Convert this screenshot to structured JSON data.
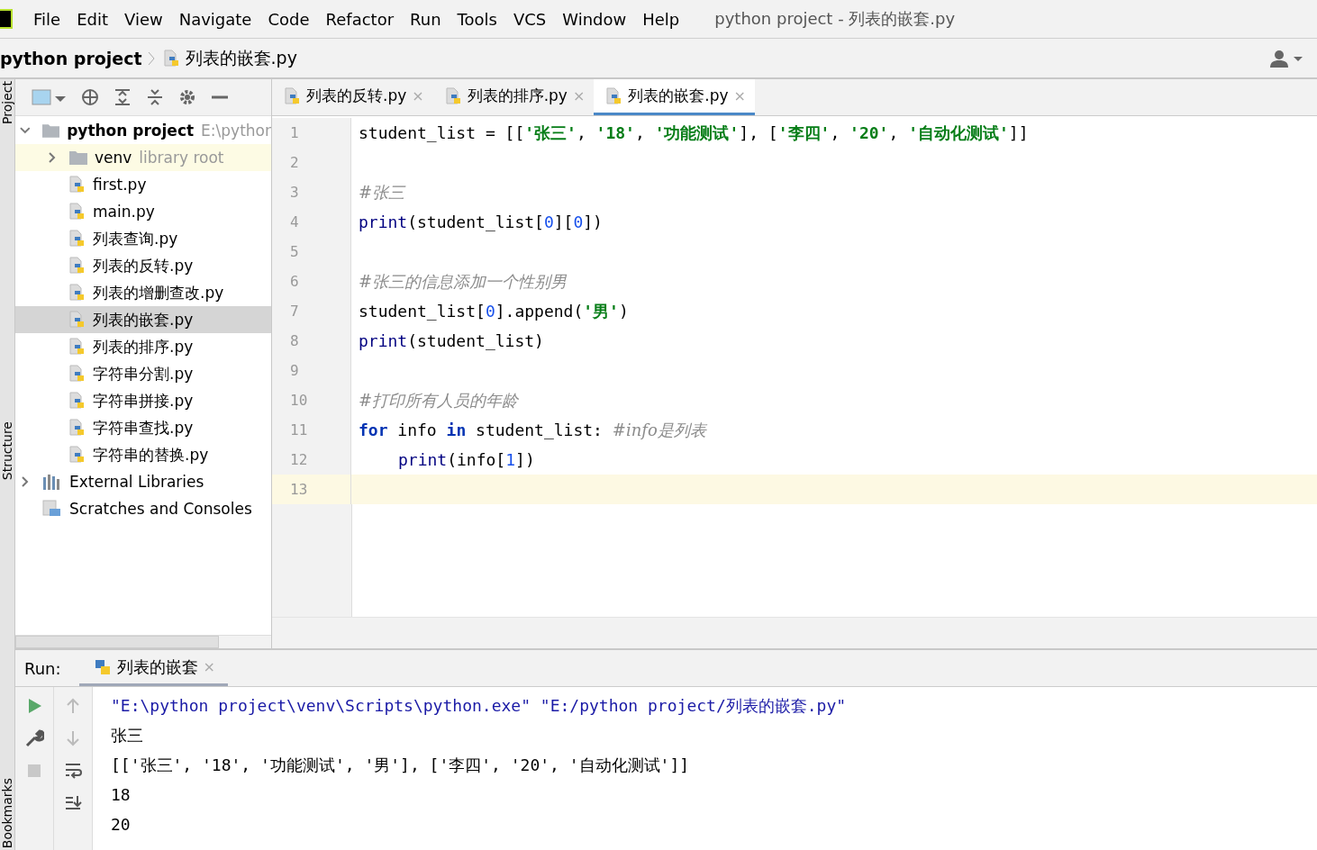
{
  "menu": [
    "File",
    "Edit",
    "View",
    "Navigate",
    "Code",
    "Refactor",
    "Run",
    "Tools",
    "VCS",
    "Window",
    "Help"
  ],
  "window_title": "python project - 列表的嵌套.py",
  "breadcrumb": [
    "python project",
    "列表的嵌套.py"
  ],
  "side_labels": [
    "Project",
    "Structure",
    "Bookmarks"
  ],
  "tree": [
    {
      "kind": "folder",
      "label": "python project",
      "hint": "E:\\pythor",
      "expanded": true,
      "selected": false,
      "children": [
        {
          "kind": "folder",
          "label": "venv",
          "hint": "library root",
          "expanded": false,
          "selected": false
        },
        {
          "kind": "file",
          "label": "first.py",
          "selected": false
        },
        {
          "kind": "file",
          "label": "main.py",
          "selected": false
        },
        {
          "kind": "file",
          "label": "列表查询.py",
          "selected": false
        },
        {
          "kind": "file",
          "label": "列表的反转.py",
          "selected": false
        },
        {
          "kind": "file",
          "label": "列表的增删查改.py",
          "selected": false
        },
        {
          "kind": "file",
          "label": "列表的嵌套.py",
          "selected": true
        },
        {
          "kind": "file",
          "label": "列表的排序.py",
          "selected": false
        },
        {
          "kind": "file",
          "label": "字符串分割.py",
          "selected": false
        },
        {
          "kind": "file",
          "label": "字符串拼接.py",
          "selected": false
        },
        {
          "kind": "file",
          "label": "字符串查找.py",
          "selected": false
        },
        {
          "kind": "file",
          "label": "字符串的替换.py",
          "selected": false
        }
      ]
    },
    {
      "kind": "libraries",
      "label": "External Libraries",
      "expanded": false,
      "selected": false
    },
    {
      "kind": "scratches",
      "label": "Scratches and Consoles",
      "selected": false
    }
  ],
  "tabs": [
    {
      "label": "列表的反转.py",
      "close": "×",
      "selected": false
    },
    {
      "label": "列表的排序.py",
      "close": "×",
      "selected": false
    },
    {
      "label": "列表的嵌套.py",
      "close": "×",
      "selected": true
    }
  ],
  "code": [
    {
      "number": "1",
      "current": false,
      "tokens": [
        {
          "kind": "plain",
          "text": "student_list = [["
        },
        {
          "kind": "string",
          "text": "'张三'"
        },
        {
          "kind": "plain",
          "text": ", "
        },
        {
          "kind": "string",
          "text": "'18'"
        },
        {
          "kind": "plain",
          "text": ", "
        },
        {
          "kind": "string",
          "text": "'功能测试'"
        },
        {
          "kind": "plain",
          "text": "], ["
        },
        {
          "kind": "string",
          "text": "'李四'"
        },
        {
          "kind": "plain",
          "text": ", "
        },
        {
          "kind": "string",
          "text": "'20'"
        },
        {
          "kind": "plain",
          "text": ", "
        },
        {
          "kind": "string",
          "text": "'自动化测试'"
        },
        {
          "kind": "plain",
          "text": "]]"
        }
      ]
    },
    {
      "number": "2",
      "current": false
    },
    {
      "number": "3",
      "current": false,
      "tokens": [
        {
          "kind": "comment",
          "text": "#张三"
        }
      ]
    },
    {
      "number": "4",
      "current": false,
      "tokens": [
        {
          "kind": "builtin",
          "text": "print"
        },
        {
          "kind": "plain",
          "text": "(student_list["
        },
        {
          "kind": "number",
          "text": "0"
        },
        {
          "kind": "plain",
          "text": "]["
        },
        {
          "kind": "number",
          "text": "0"
        },
        {
          "kind": "plain",
          "text": "])"
        }
      ]
    },
    {
      "number": "5",
      "current": false
    },
    {
      "number": "6",
      "current": false,
      "tokens": [
        {
          "kind": "comment",
          "text": "#张三的信息添加一个性别男"
        }
      ]
    },
    {
      "number": "7",
      "current": false,
      "tokens": [
        {
          "kind": "plain",
          "text": "student_list["
        },
        {
          "kind": "number",
          "text": "0"
        },
        {
          "kind": "plain",
          "text": "].append("
        },
        {
          "kind": "string",
          "text": "'男'"
        },
        {
          "kind": "plain",
          "text": ")"
        }
      ]
    },
    {
      "number": "8",
      "current": false,
      "tokens": [
        {
          "kind": "builtin",
          "text": "print"
        },
        {
          "kind": "plain",
          "text": "(student_list)"
        }
      ]
    },
    {
      "number": "9",
      "current": false
    },
    {
      "number": "10",
      "current": false,
      "tokens": [
        {
          "kind": "comment",
          "text": "#打印所有人员的年龄"
        }
      ]
    },
    {
      "number": "11",
      "current": false,
      "tokens": [
        {
          "kind": "keyword",
          "text": "for"
        },
        {
          "kind": "plain",
          "text": " info "
        },
        {
          "kind": "keyword",
          "text": "in"
        },
        {
          "kind": "plain",
          "text": " student_list: "
        },
        {
          "kind": "comment",
          "text": "#info是列表"
        }
      ]
    },
    {
      "number": "12",
      "current": false,
      "indent": true,
      "tokens": [
        {
          "kind": "builtin",
          "text": "print"
        },
        {
          "kind": "plain",
          "text": "(info["
        },
        {
          "kind": "number",
          "text": "1"
        },
        {
          "kind": "plain",
          "text": "])"
        }
      ]
    },
    {
      "number": "13",
      "current": true
    }
  ],
  "run": {
    "label": "Run:",
    "tab": "列表的嵌套",
    "close": "×",
    "output": [
      {
        "kind": "command",
        "text": "\"E:\\python project\\venv\\Scripts\\python.exe\" \"E:/python project/列表的嵌套.py\""
      },
      {
        "kind": "plain",
        "text": "张三"
      },
      {
        "kind": "plain",
        "text": "[['张三', '18', '功能测试', '男'], ['李四', '20', '自动化测试']]"
      },
      {
        "kind": "plain",
        "text": "18"
      },
      {
        "kind": "plain",
        "text": "20"
      }
    ]
  }
}
